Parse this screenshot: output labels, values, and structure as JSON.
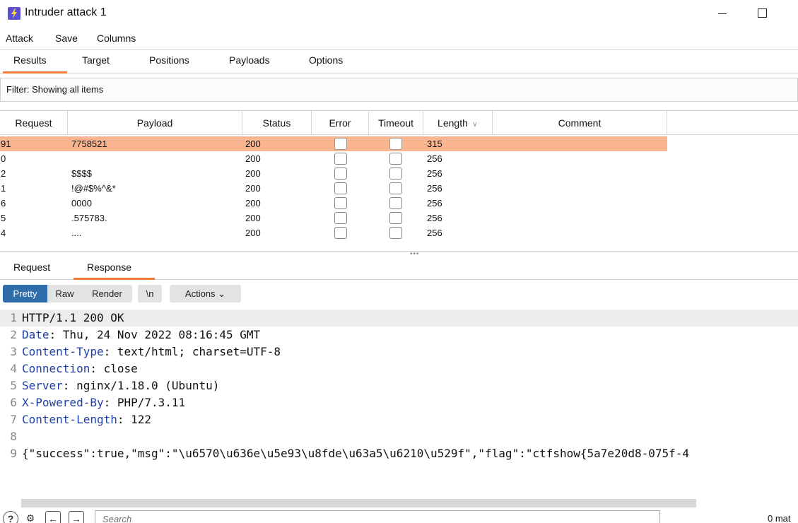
{
  "window": {
    "title": "Intruder attack 1"
  },
  "menu": [
    "Attack",
    "Save",
    "Columns"
  ],
  "tabs": [
    "Results",
    "Target",
    "Positions",
    "Payloads",
    "Options"
  ],
  "filter": {
    "text": "Filter: Showing all items"
  },
  "table": {
    "columns": [
      "Request",
      "Payload",
      "Status",
      "Error",
      "Timeout",
      "Length",
      "Comment"
    ],
    "sort_column": "Length",
    "rows": [
      {
        "request": "91",
        "payload": "7758521",
        "status": "200",
        "error": false,
        "timeout": false,
        "length": "315",
        "comment": "",
        "selected": true
      },
      {
        "request": "0",
        "payload": "",
        "status": "200",
        "error": false,
        "timeout": false,
        "length": "256",
        "comment": "",
        "selected": false
      },
      {
        "request": "2",
        "payload": "$$$$",
        "status": "200",
        "error": false,
        "timeout": false,
        "length": "256",
        "comment": "",
        "selected": false
      },
      {
        "request": "1",
        "payload": "!@#$%^&*",
        "status": "200",
        "error": false,
        "timeout": false,
        "length": "256",
        "comment": "",
        "selected": false
      },
      {
        "request": "6",
        "payload": "0000",
        "status": "200",
        "error": false,
        "timeout": false,
        "length": "256",
        "comment": "",
        "selected": false
      },
      {
        "request": "5",
        "payload": ".575783.",
        "status": "200",
        "error": false,
        "timeout": false,
        "length": "256",
        "comment": "",
        "selected": false
      },
      {
        "request": "4",
        "payload": "....",
        "status": "200",
        "error": false,
        "timeout": false,
        "length": "256",
        "comment": "",
        "selected": false
      }
    ]
  },
  "subtabs": [
    "Request",
    "Response"
  ],
  "active_subtab": "Response",
  "view_buttons": [
    "Pretty",
    "Raw",
    "Render",
    "\\n",
    "Actions"
  ],
  "active_view": "Pretty",
  "response_lines": [
    {
      "num": "1",
      "name": "",
      "value": "HTTP/1.1 200 OK"
    },
    {
      "num": "2",
      "name": "Date",
      "value": ": Thu, 24 Nov 2022 08:16:45 GMT"
    },
    {
      "num": "3",
      "name": "Content-Type",
      "value": ": text/html; charset=UTF-8"
    },
    {
      "num": "4",
      "name": "Connection",
      "value": ": close"
    },
    {
      "num": "5",
      "name": "Server",
      "value": ": nginx/1.18.0 (Ubuntu)"
    },
    {
      "num": "6",
      "name": "X-Powered-By",
      "value": ": PHP/7.3.11"
    },
    {
      "num": "7",
      "name": "Content-Length",
      "value": ": 122"
    },
    {
      "num": "8",
      "name": "",
      "value": ""
    },
    {
      "num": "9",
      "name": "",
      "value": "{\"success\":true,\"msg\":\"\\u6570\\u636e\\u5e93\\u8fde\\u63a5\\u6210\\u529f\",\"flag\":\"ctfshow{5a7e20d8-075f-4"
    }
  ],
  "search": {
    "placeholder": "Search"
  },
  "matches": "0 mat",
  "colors": {
    "accent": "#ef7d35",
    "selected_row": "#f8b58f",
    "active_button": "#2f6eaa",
    "header_name": "#1d3fa8"
  }
}
